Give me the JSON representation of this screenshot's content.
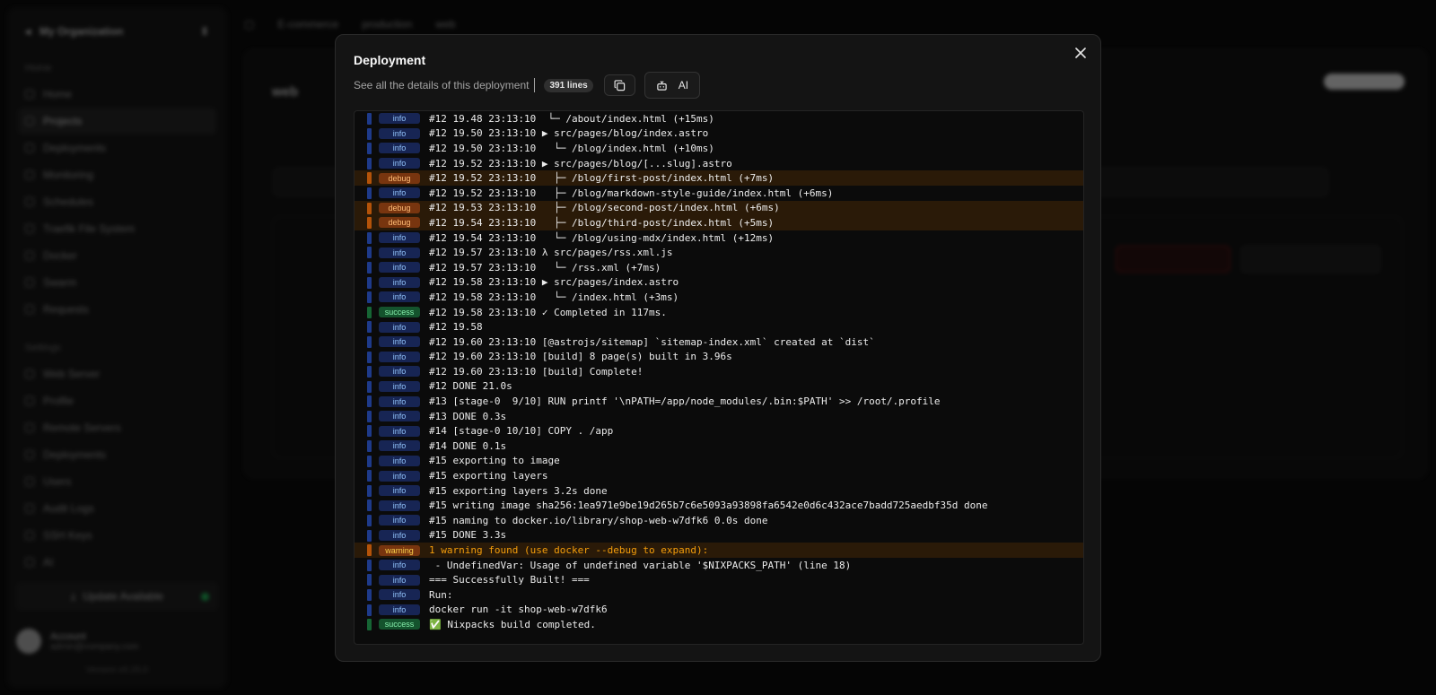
{
  "background": {
    "sidebar": {
      "org_name": "My Organization",
      "section_home": "Home",
      "home_items": [
        "Home",
        "Projects",
        "Deployments",
        "Monitoring",
        "Schedules",
        "Traefik File System",
        "Docker",
        "Swarm",
        "Requests"
      ],
      "section_settings": "Settings",
      "settings_items": [
        "Web Server",
        "Profile",
        "Remote Servers",
        "Deployments",
        "Users",
        "Audit Logs",
        "SSH Keys",
        "AI"
      ],
      "update_label": "Update Available",
      "user_name": "Account",
      "user_email": "admin@company.com",
      "version": "Version v0.25.0"
    },
    "topbar": [
      "E-commerce",
      "production",
      "web"
    ],
    "service_name": "web"
  },
  "modal": {
    "title": "Deployment",
    "description": "See all the details of this deployment",
    "line_count": "391 lines",
    "copy_icon": "copy-icon",
    "ai_icon": "bot-icon",
    "ai_label": "AI",
    "close_icon": "close-icon"
  },
  "logs": [
    {
      "level": "info",
      "text": "#12 19.48 23:13:10  └─ /about/index.html (+15ms)"
    },
    {
      "level": "info",
      "text": "#12 19.50 23:13:10 ▶ src/pages/blog/index.astro"
    },
    {
      "level": "info",
      "text": "#12 19.50 23:13:10   └─ /blog/index.html (+10ms)"
    },
    {
      "level": "info",
      "text": "#12 19.52 23:13:10 ▶ src/pages/blog/[...slug].astro"
    },
    {
      "level": "debug",
      "text": "#12 19.52 23:13:10   ├─ /blog/first-post/index.html (+7ms)"
    },
    {
      "level": "info",
      "text": "#12 19.52 23:13:10   ├─ /blog/markdown-style-guide/index.html (+6ms)"
    },
    {
      "level": "debug",
      "text": "#12 19.53 23:13:10   ├─ /blog/second-post/index.html (+6ms)"
    },
    {
      "level": "debug",
      "text": "#12 19.54 23:13:10   ├─ /blog/third-post/index.html (+5ms)"
    },
    {
      "level": "info",
      "text": "#12 19.54 23:13:10   └─ /blog/using-mdx/index.html (+12ms)"
    },
    {
      "level": "info",
      "text": "#12 19.57 23:13:10 λ src/pages/rss.xml.js"
    },
    {
      "level": "info",
      "text": "#12 19.57 23:13:10   └─ /rss.xml (+7ms)"
    },
    {
      "level": "info",
      "text": "#12 19.58 23:13:10 ▶ src/pages/index.astro"
    },
    {
      "level": "info",
      "text": "#12 19.58 23:13:10   └─ /index.html (+3ms)"
    },
    {
      "level": "success",
      "text": "#12 19.58 23:13:10 ✓ Completed in 117ms."
    },
    {
      "level": "info",
      "text": "#12 19.58"
    },
    {
      "level": "info",
      "text": "#12 19.60 23:13:10 [@astrojs/sitemap] `sitemap-index.xml` created at `dist`"
    },
    {
      "level": "info",
      "text": "#12 19.60 23:13:10 [build] 8 page(s) built in 3.96s"
    },
    {
      "level": "info",
      "text": "#12 19.60 23:13:10 [build] Complete!"
    },
    {
      "level": "info",
      "text": "#12 DONE 21.0s"
    },
    {
      "level": "info",
      "text": "#13 [stage-0  9/10] RUN printf '\\nPATH=/app/node_modules/.bin:$PATH' >> /root/.profile"
    },
    {
      "level": "info",
      "text": "#13 DONE 0.3s"
    },
    {
      "level": "info",
      "text": "#14 [stage-0 10/10] COPY . /app"
    },
    {
      "level": "info",
      "text": "#14 DONE 0.1s"
    },
    {
      "level": "info",
      "text": "#15 exporting to image"
    },
    {
      "level": "info",
      "text": "#15 exporting layers"
    },
    {
      "level": "info",
      "text": "#15 exporting layers 3.2s done"
    },
    {
      "level": "info",
      "text": "#15 writing image sha256:1ea971e9be19d265b7c6e5093a93898fa6542e0d6c432ace7badd725aedbf35d done"
    },
    {
      "level": "info",
      "text": "#15 naming to docker.io/library/shop-web-w7dfk6 0.0s done"
    },
    {
      "level": "info",
      "text": "#15 DONE 3.3s"
    },
    {
      "level": "warning",
      "text": "1 warning found (use docker --debug to expand):"
    },
    {
      "level": "info",
      "text": " - UndefinedVar: Usage of undefined variable '$NIXPACKS_PATH' (line 18)"
    },
    {
      "level": "info",
      "text": "=== Successfully Built! ==="
    },
    {
      "level": "info",
      "text": "Run:"
    },
    {
      "level": "info",
      "text": "docker run -it shop-web-w7dfk6"
    },
    {
      "level": "success",
      "text": "✅ Nixpacks build completed."
    }
  ]
}
